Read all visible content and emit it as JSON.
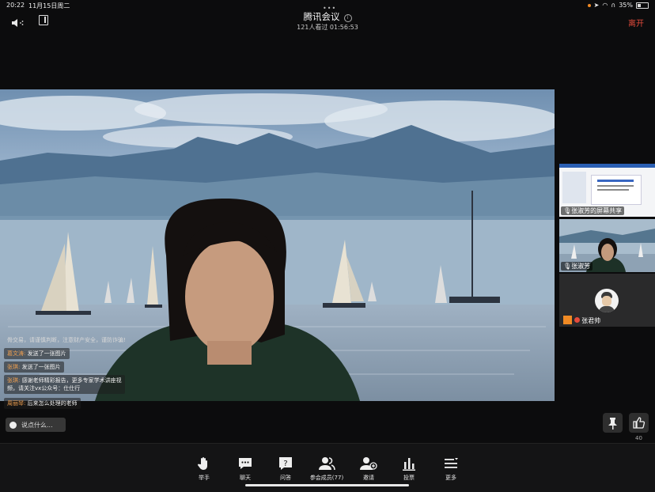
{
  "status_bar": {
    "time": "20:22",
    "date": "11月15日周二",
    "battery": "35%"
  },
  "header": {
    "title": "腾讯会议",
    "subtitle": "121人看过  01:56:53",
    "leave_label": "离开"
  },
  "chat": {
    "messages": [
      {
        "name": "",
        "text": "骨交易，请谨慎判断，注意财产安全，谨防诈骗!"
      },
      {
        "name": "葛文涛:",
        "text": "发送了一张图片"
      },
      {
        "name": "张琪:",
        "text": "发送了一张图片"
      },
      {
        "name": "张琪:",
        "text": "感谢老师精彩报告，更多专家学术讲座视"
      },
      {
        "name": "",
        "text": "频，请关注vx公众号：仕仕行"
      },
      {
        "name": "周丽琴:",
        "text": "后来怎么处理的老师"
      }
    ],
    "input_placeholder": "说点什么..."
  },
  "participants": [
    {
      "label": "张淑芳的屏幕共享"
    },
    {
      "label": "张淑芳"
    },
    {
      "label": "张君帅"
    }
  ],
  "likes": {
    "count": "40"
  },
  "toolbar": {
    "items": [
      {
        "label": "举手",
        "icon": "raise-hand-icon"
      },
      {
        "label": "聊天",
        "icon": "chat-icon"
      },
      {
        "label": "问答",
        "icon": "qa-icon"
      },
      {
        "label": "参会成员(77)",
        "icon": "members-icon"
      },
      {
        "label": "邀请",
        "icon": "invite-icon"
      },
      {
        "label": "投票",
        "icon": "vote-icon"
      },
      {
        "label": "更多",
        "icon": "more-icon"
      }
    ]
  },
  "colors": {
    "leave": "#e54b3c",
    "background": "#0c0c0d",
    "toolbar": "#141415"
  }
}
